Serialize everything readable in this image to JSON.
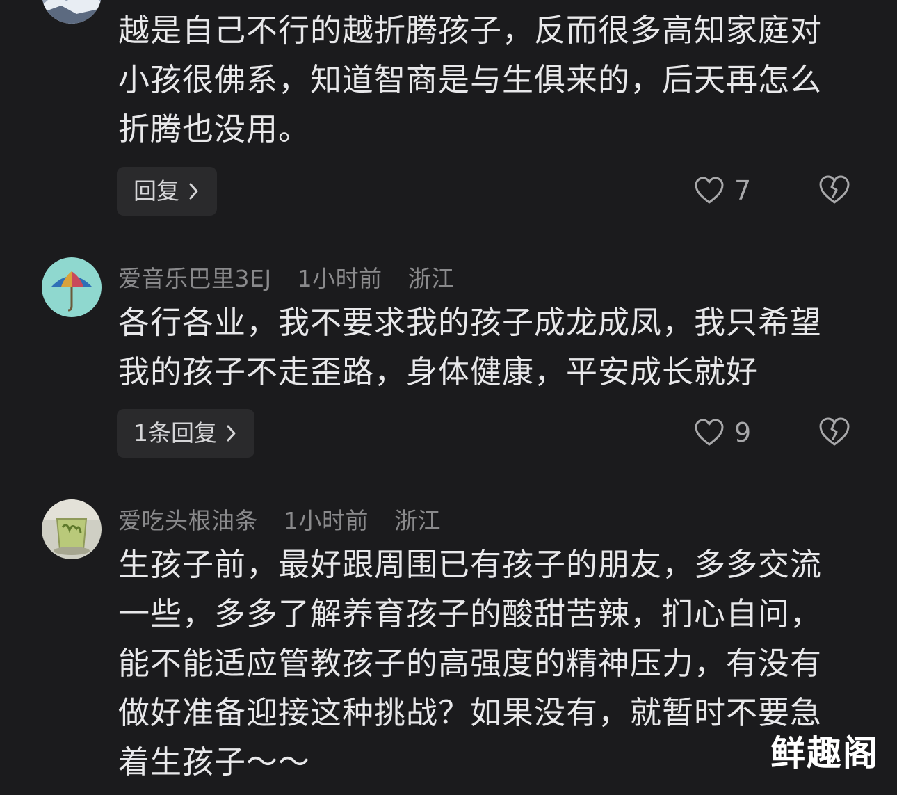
{
  "comments": [
    {
      "text_lines": [
        "越是自己不行的越折腾孩子，反而很多高知家庭对",
        "小孩很佛系，知道智商是与生俱来的，后天再怎么",
        "折腾也没用。"
      ],
      "reply_label": "回复",
      "likes": "7",
      "avatar_icon": "landscape-avatar"
    },
    {
      "username": "爱音乐巴里3EJ",
      "time": "1小时前",
      "location": "浙江",
      "text_lines": [
        "各行各业，我不要求我的孩子成龙成凤，我只希望",
        "我的孩子不走歪路，身体健康，平安成长就好"
      ],
      "reply_label": "1条回复",
      "likes": "9",
      "avatar_icon": "umbrella-avatar"
    },
    {
      "username": "爱吃头根油条",
      "time": "1小时前",
      "location": "浙江",
      "text_lines": [
        "生孩子前，最好跟周围已有孩子的朋友，多多交流",
        "一些，多多了解养育孩子的酸甜苦辣，扪心自问，",
        "能不能适应管教孩子的高强度的精神压力，有没有",
        "做好准备迎接这种挑战？如果没有，就暂时不要急",
        "着生孩子～～"
      ],
      "avatar_icon": "tea-cup-avatar"
    }
  ],
  "icons": {
    "like": "heart-outline-icon",
    "dislike": "broken-heart-icon",
    "chevron": "chevron-right-icon"
  },
  "watermark": "鲜趣阁"
}
